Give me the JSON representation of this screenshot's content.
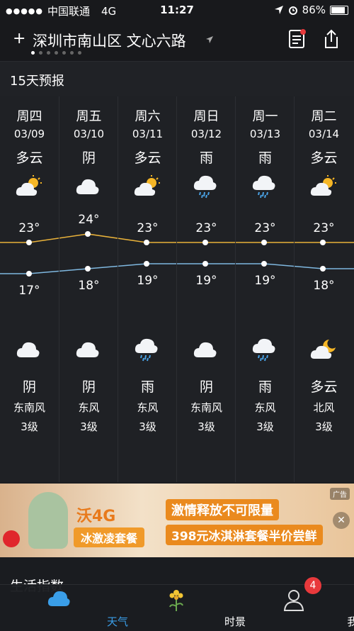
{
  "status": {
    "signal": "●●●●●",
    "carrier": "中国联通",
    "network": "4G",
    "time": "11:27",
    "battery": "86%"
  },
  "header": {
    "plus": "+",
    "location": "深圳市南山区 文心六路"
  },
  "section_title": "15天预报",
  "days": [
    {
      "day": "周四",
      "date": "03/09",
      "cond_day": "多云",
      "icon_day": "partly-cloudy-sun-icon",
      "high": "23°",
      "low": "17°",
      "icon_night": "cloud-icon",
      "cond_night": "阴",
      "wind": "东南风",
      "level": "3级"
    },
    {
      "day": "周五",
      "date": "03/10",
      "cond_day": "阴",
      "icon_day": "cloud-icon",
      "high": "24°",
      "low": "18°",
      "icon_night": "cloud-icon",
      "cond_night": "阴",
      "wind": "东风",
      "level": "3级"
    },
    {
      "day": "周六",
      "date": "03/11",
      "cond_day": "多云",
      "icon_day": "partly-cloudy-sun-icon",
      "high": "23°",
      "low": "19°",
      "icon_night": "rain-icon",
      "cond_night": "雨",
      "wind": "东风",
      "level": "3级"
    },
    {
      "day": "周日",
      "date": "03/12",
      "cond_day": "雨",
      "icon_day": "rain-icon",
      "high": "23°",
      "low": "19°",
      "icon_night": "cloud-icon",
      "cond_night": "阴",
      "wind": "东南风",
      "level": "3级"
    },
    {
      "day": "周一",
      "date": "03/13",
      "cond_day": "雨",
      "icon_day": "rain-icon",
      "high": "23°",
      "low": "19°",
      "icon_night": "rain-icon",
      "cond_night": "雨",
      "wind": "东风",
      "level": "3级"
    },
    {
      "day": "周二",
      "date": "03/14",
      "cond_day": "多云",
      "icon_day": "partly-cloudy-sun-icon",
      "high": "23°",
      "low": "18°",
      "icon_night": "partly-cloudy-moon-icon",
      "cond_night": "多云",
      "wind": "北风",
      "level": "3级"
    }
  ],
  "high_values": [
    23,
    24,
    23,
    23,
    23,
    23
  ],
  "low_values": [
    17,
    18,
    19,
    19,
    19,
    18
  ],
  "colors": {
    "high_line": "#e9b23a",
    "low_line": "#7fb8e0",
    "accent": "#3a9ee8",
    "badge": "#e8393c"
  },
  "ad": {
    "badge": "广告",
    "brand": "沃4G",
    "pkg": "冰激凌套餐",
    "slogan1": "激情释放不可限量",
    "slogan2": "398元冰淇淋套餐半价尝鲜"
  },
  "life_title": "生活指数",
  "tabs": [
    {
      "label": "天气",
      "icon": "cloud-icon",
      "active": true
    },
    {
      "label": "时景",
      "icon": "flower-icon",
      "active": false
    },
    {
      "label": "我",
      "icon": "person-icon",
      "active": false
    }
  ],
  "notification_count": "4"
}
